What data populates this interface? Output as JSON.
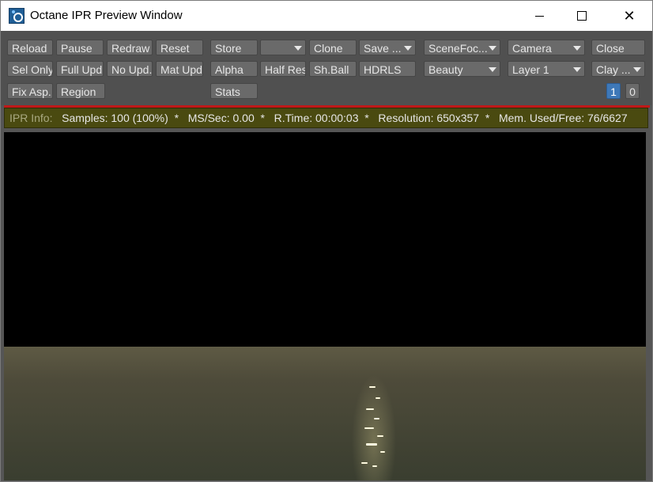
{
  "window": {
    "title": "Octane IPR Preview Window"
  },
  "toolbar": {
    "reload": "Reload",
    "pause": "Pause",
    "redraw": "Redraw",
    "reset": "Reset",
    "store": "Store",
    "store_select": "",
    "clone": "Clone",
    "save": "Save ...",
    "scene_focus": "SceneFoc...",
    "camera": "Camera",
    "close": "Close",
    "sel_only": "Sel Only",
    "full_upd": "Full Upd.",
    "no_upd": "No Upd.",
    "mat_upd": "Mat Upd",
    "alpha": "Alpha",
    "half_res": "Half Res",
    "sh_ball": "Sh.Ball",
    "hdrls": "HDRLS",
    "beauty": "Beauty",
    "layer": "Layer 1",
    "clay": "Clay ...",
    "fix_asp": "Fix Asp.",
    "region": "Region",
    "stats": "Stats",
    "page_1": "1",
    "page_0": "0"
  },
  "info": {
    "label": "IPR Info:",
    "samples": "Samples: 100 (100%)",
    "ms_sec": "MS/Sec: 0.00",
    "r_time": "R.Time: 00:00:03",
    "resolution": "Resolution: 650x357",
    "mem": "Mem. Used/Free: 76/6627",
    "separator": "*"
  },
  "colors": {
    "toolbar_bg": "#505050",
    "button_bg": "#6a6a6a",
    "active_blue": "#3e78b8",
    "info_bg": "#4a4a10",
    "accent_red": "#c01818"
  }
}
